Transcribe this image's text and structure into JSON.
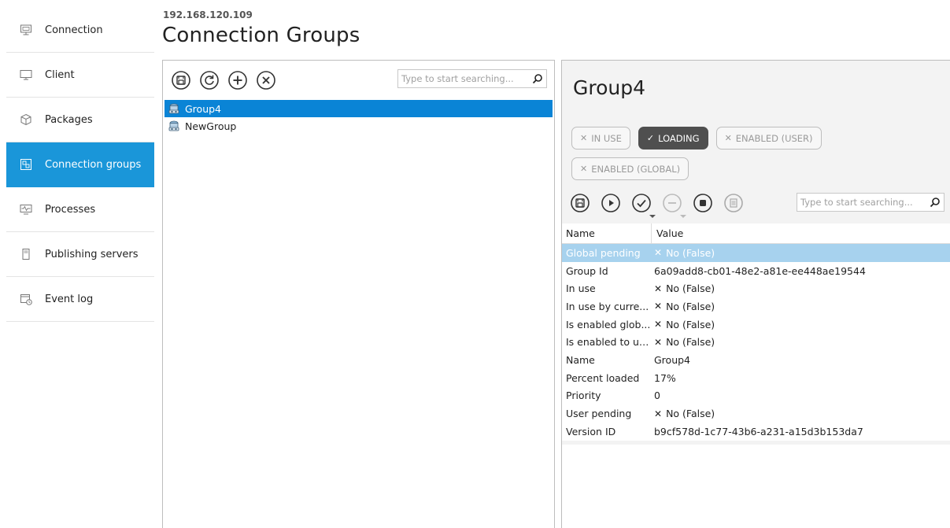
{
  "sidebar": {
    "items": [
      {
        "label": "Connection",
        "icon": "monitor-stand-icon"
      },
      {
        "label": "Client",
        "icon": "monitor-icon"
      },
      {
        "label": "Packages",
        "icon": "cube-icon"
      },
      {
        "label": "Connection groups",
        "icon": "group-icon",
        "active": true
      },
      {
        "label": "Processes",
        "icon": "process-monitor-icon"
      },
      {
        "label": "Publishing servers",
        "icon": "server-icon"
      },
      {
        "label": "Event log",
        "icon": "calendar-clock-icon"
      }
    ]
  },
  "header": {
    "address": "192.168.120.109",
    "title": "Connection Groups"
  },
  "left_pane": {
    "toolbar": [
      "save-icon",
      "refresh-icon",
      "add-icon",
      "remove-icon"
    ],
    "search_placeholder": "Type to start searching...",
    "groups": [
      {
        "label": "Group4",
        "selected": true
      },
      {
        "label": "NewGroup",
        "selected": false
      }
    ]
  },
  "detail": {
    "title": "Group4",
    "badges": [
      {
        "label": "IN USE",
        "active": false
      },
      {
        "label": "LOADING",
        "active": true
      },
      {
        "label": "ENABLED (USER)",
        "active": false
      },
      {
        "label": "ENABLED (GLOBAL)",
        "active": false
      }
    ],
    "toolbar": [
      "save-icon",
      "play-icon",
      "check-icon",
      "minus-icon",
      "stop-icon",
      "list-icon"
    ],
    "search_placeholder": "Type to start searching...",
    "columns": {
      "name": "Name",
      "value": "Value"
    },
    "rows": [
      {
        "name": "Global pending",
        "value": "No (False)",
        "bool": true,
        "selected": true
      },
      {
        "name": "Group Id",
        "value": "6a09add8-cb01-48e2-a81e-ee448ae19544",
        "bool": false
      },
      {
        "name": "In use",
        "value": "No (False)",
        "bool": true
      },
      {
        "name": "In use by curre...",
        "value": "No (False)",
        "bool": true
      },
      {
        "name": "Is enabled glob...",
        "value": "No (False)",
        "bool": true
      },
      {
        "name": "Is enabled to us...",
        "value": "No (False)",
        "bool": true
      },
      {
        "name": "Name",
        "value": "Group4",
        "bool": false
      },
      {
        "name": "Percent loaded",
        "value": "17%",
        "bool": false
      },
      {
        "name": "Priority",
        "value": "0",
        "bool": false
      },
      {
        "name": "User pending",
        "value": "No (False)",
        "bool": true
      },
      {
        "name": "Version ID",
        "value": "b9cf578d-1c77-43b6-a231-a15d3b153da7",
        "bool": false
      }
    ]
  },
  "colors": {
    "accent": "#1a96d9",
    "selection": "#0a84d6",
    "grid_selection": "#a7d2ee",
    "badge_active": "#4f4f4f"
  }
}
